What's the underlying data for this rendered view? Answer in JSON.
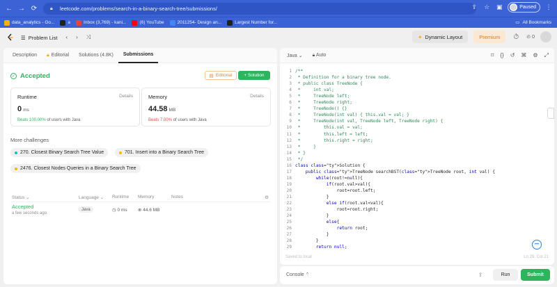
{
  "browser": {
    "url": "leetcode.com/problems/search-in-a-binary-search-tree/submissions/",
    "paused_label": "Paused",
    "bookmarks": [
      {
        "label": "data_analytics - Go...",
        "color": "#f4b400"
      },
      {
        "label": "a",
        "color": "#202124"
      },
      {
        "label": "Inbox (3,769) - kani...",
        "color": "#ea4335"
      },
      {
        "label": "(6) YouTube",
        "color": "#ff0000"
      },
      {
        "label": "2011254- Design an...",
        "color": "#4285f4"
      },
      {
        "label": "Largest Number for...",
        "color": "#202124"
      }
    ],
    "all_bookmarks": "All Bookmarks"
  },
  "nav": {
    "problem_list": "Problem List",
    "dynamic_layout": "Dynamic Layout",
    "premium": "Premium",
    "streak_count": "0"
  },
  "tabs": [
    {
      "label": "Description"
    },
    {
      "label": "Editorial"
    },
    {
      "label": "Solutions (4.8K)"
    },
    {
      "label": "Submissions"
    }
  ],
  "result": {
    "status": "Accepted",
    "editorial_button": "Editorial",
    "solution_button": "+ Solution"
  },
  "runtime": {
    "title": "Runtime",
    "details": "Details",
    "value": "0",
    "unit": "ms",
    "beats_highlight": "Beats 100.00%",
    "beats_rest": "of users with Java",
    "beats_color": "#2db55d"
  },
  "memory": {
    "title": "Memory",
    "details": "Details",
    "value": "44.58",
    "unit": "MB",
    "beats_highlight": "Beats 7.00%",
    "beats_rest": "of users with Java",
    "beats_color": "#ef4743"
  },
  "challenges": {
    "title": "More challenges",
    "items": [
      {
        "label": "270. Closest Binary Search Tree Value",
        "color": "#15bdc3"
      },
      {
        "label": "701. Insert into a Binary Search Tree",
        "color": "#ffb800"
      },
      {
        "label": "2476. Closest Nodes Queries in a Binary Search Tree",
        "color": "#ffb800"
      }
    ]
  },
  "submissions": {
    "headers": [
      "Status",
      "Language",
      "Runtime",
      "Memory",
      "Notes"
    ],
    "row": {
      "status": "Accepted",
      "time": "a few seconds ago",
      "language": "Java",
      "runtime": "0 ms",
      "memory": "44.6 MB"
    }
  },
  "editor": {
    "language": "Java",
    "mode": "Auto",
    "saved": "Saved to local",
    "cursor": "Ln 29, Col 21",
    "lines": [
      "/**",
      " * Definition for a binary tree node.",
      " * public class TreeNode {",
      " *     int val;",
      " *     TreeNode left;",
      " *     TreeNode right;",
      " *     TreeNode() {}",
      " *     TreeNode(int val) { this.val = val; }",
      " *     TreeNode(int val, TreeNode left, TreeNode right) {",
      " *         this.val = val;",
      " *         this.left = left;",
      " *         this.right = right;",
      " *     }",
      " * }",
      " */",
      "class Solution {",
      "    public TreeNode searchBST(TreeNode root, int val) {",
      "        while(root!=null){",
      "            if(root.val>val){",
      "                root=root.left;",
      "            }",
      "            else if(root.val<val){",
      "                root=root.right;",
      "            }",
      "            else{",
      "                return root;",
      "            }",
      "        }",
      "        return null;"
    ]
  },
  "console": {
    "label": "Console",
    "run": "Run",
    "submit": "Submit"
  }
}
